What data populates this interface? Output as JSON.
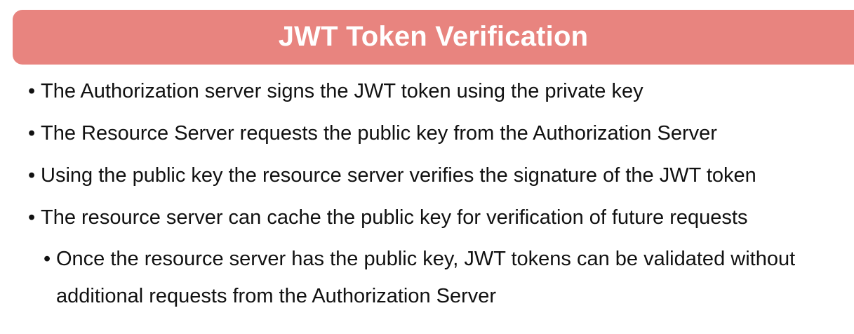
{
  "slide": {
    "title": "JWT Token Verification",
    "bullet_marker": "•",
    "bullets": [
      {
        "text": "The Authorization server signs the JWT token using the private key"
      },
      {
        "text": "The Resource Server requests the public key from the Authorization Server"
      },
      {
        "text": "Using the public key the resource server verifies the signature of the JWT token"
      },
      {
        "text": "The resource server can cache the public key for verification of future requests"
      }
    ],
    "sub_bullets": [
      {
        "text": "Once the resource server has the public key, JWT tokens can be validated without additional requests from the Authorization Server"
      }
    ]
  },
  "colors": {
    "title_bar": "#e8847f",
    "title_text": "#ffffff",
    "body_text": "#111111"
  }
}
